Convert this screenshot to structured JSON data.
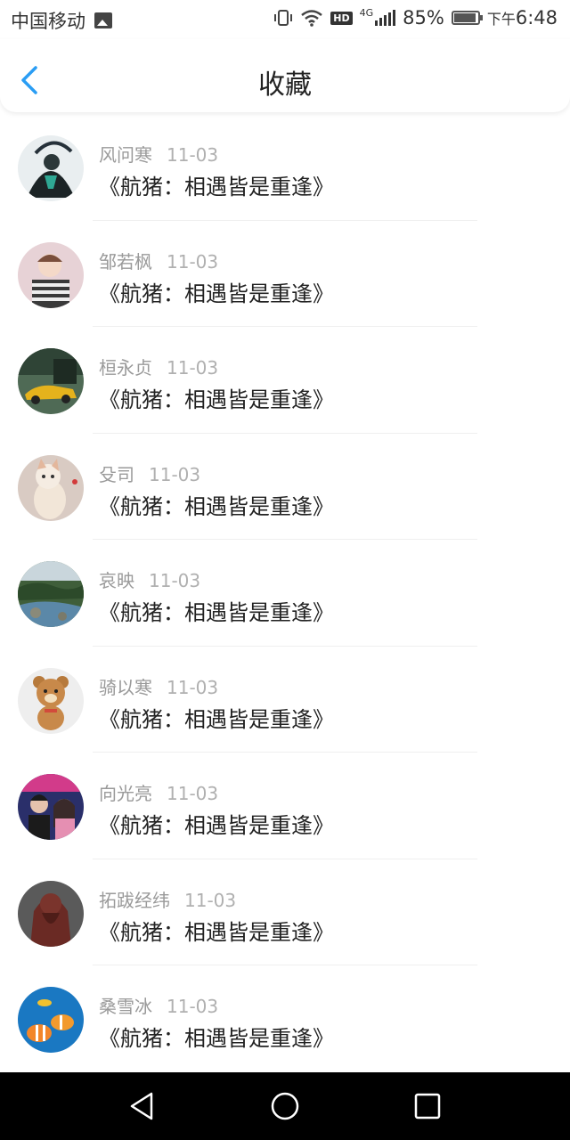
{
  "status_bar": {
    "carrier": "中国移动",
    "network": "4G",
    "battery": "85%",
    "time_prefix": "下午",
    "time": "6:48",
    "icons": [
      "image-icon",
      "vibrate-icon",
      "wifi-icon",
      "hd-icon",
      "signal-icon",
      "battery-icon"
    ]
  },
  "header": {
    "title": "收藏",
    "back_icon": "chevron-left-icon",
    "accent": "#2a9df4"
  },
  "favorites": [
    {
      "name": "风问寒",
      "date": "11-03",
      "title": "《航猪：相遇皆是重逢》"
    },
    {
      "name": "邹若枫",
      "date": "11-03",
      "title": "《航猪：相遇皆是重逢》"
    },
    {
      "name": "桓永贞",
      "date": "11-03",
      "title": "《航猪：相遇皆是重逢》"
    },
    {
      "name": "殳司",
      "date": "11-03",
      "title": "《航猪：相遇皆是重逢》"
    },
    {
      "name": "哀映",
      "date": "11-03",
      "title": "《航猪：相遇皆是重逢》"
    },
    {
      "name": "骑以寒",
      "date": "11-03",
      "title": "《航猪：相遇皆是重逢》"
    },
    {
      "name": "向光亮",
      "date": "11-03",
      "title": "《航猪：相遇皆是重逢》"
    },
    {
      "name": "拓跋经纬",
      "date": "11-03",
      "title": "《航猪：相遇皆是重逢》"
    },
    {
      "name": "桑雪冰",
      "date": "11-03",
      "title": "《航猪：相遇皆是重逢》"
    }
  ],
  "nav_bar": {
    "icons": [
      "back-triangle-icon",
      "home-circle-icon",
      "recents-square-icon"
    ]
  }
}
